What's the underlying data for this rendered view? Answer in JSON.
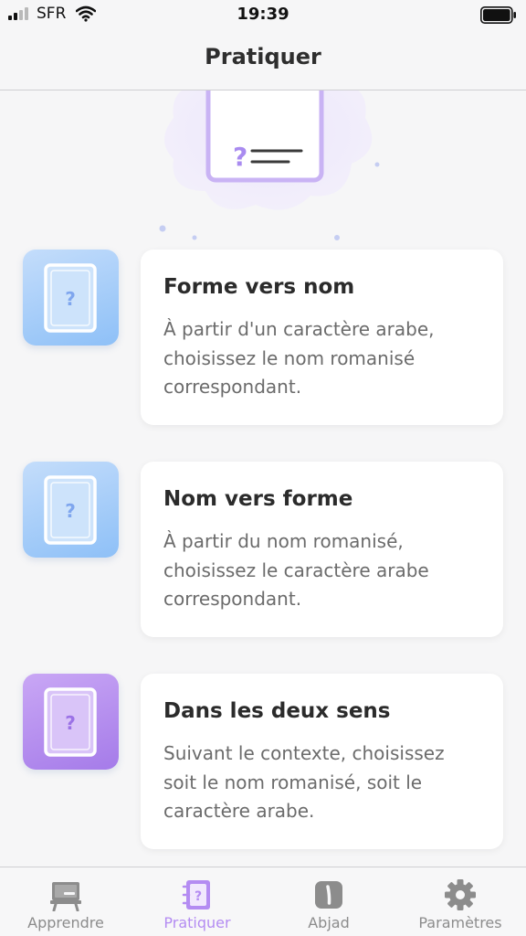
{
  "status_bar": {
    "carrier": "SFR",
    "time": "19:39"
  },
  "nav": {
    "title": "Pratiquer"
  },
  "modes": [
    {
      "title": "Forme vers nom",
      "description": "À partir d'un caractère arabe, choisissez le nom romanisé correspondant.",
      "tile_color": "blue",
      "icon": "question-card-icon"
    },
    {
      "title": "Nom vers forme",
      "description": "À partir du nom romanisé, choisissez le caractère arabe correspondant.",
      "tile_color": "blue",
      "icon": "question-card-icon"
    },
    {
      "title": "Dans les deux sens",
      "description": "Suivant le contexte, choisissez soit le nom romanisé, soit le caractère arabe.",
      "tile_color": "purple",
      "icon": "question-card-icon"
    }
  ],
  "tabs": [
    {
      "label": "Apprendre",
      "icon": "easel-icon",
      "active": false
    },
    {
      "label": "Pratiquer",
      "icon": "notebook-question-icon",
      "active": true
    },
    {
      "label": "Abjad",
      "icon": "alif-letter-icon",
      "active": false
    },
    {
      "label": "Paramètres",
      "icon": "gear-icon",
      "active": false
    }
  ],
  "colors": {
    "accent": "#b48cf2",
    "inactive_tab": "#8c8c8c",
    "tile_blue": "#a8cff8",
    "tile_purple": "#b28ff0"
  }
}
